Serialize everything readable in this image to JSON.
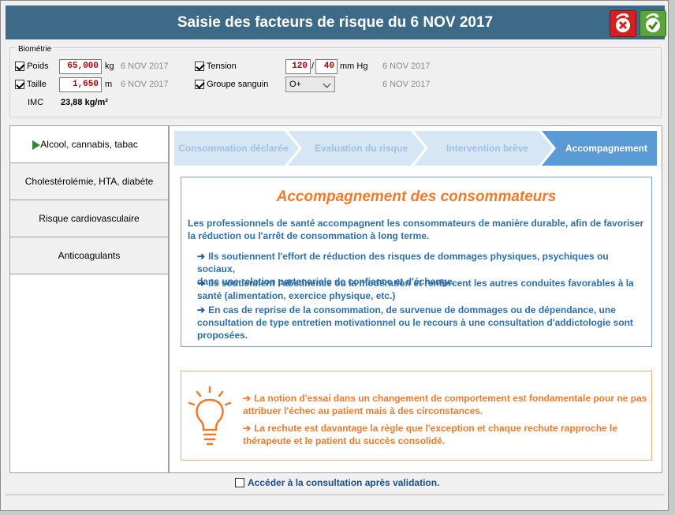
{
  "window": {
    "title": "Saisie des facteurs de risque du 6 NOV 2017"
  },
  "toolbar": {
    "cancel_icon": "cancel-icon",
    "validate_icon": "validate-icon"
  },
  "biometrie": {
    "legend": "Biométrie",
    "poids": {
      "label": "Poids",
      "value": "65,000",
      "unit": "kg",
      "date": "6 NOV 2017",
      "checked": true
    },
    "taille": {
      "label": "Taille",
      "value": "1,650",
      "unit": "m",
      "date": "6 NOV 2017",
      "checked": true
    },
    "imc": {
      "label": "IMC",
      "value": "23,88 kg/m²"
    },
    "tension": {
      "label": "Tension",
      "systolic": "120",
      "separator": "/",
      "diastolic": "40",
      "unit": "mm Hg",
      "date": "6 NOV 2017",
      "checked": true
    },
    "groupe": {
      "label": "Groupe sanguin",
      "value": "O+",
      "date": "6 NOV 2017",
      "checked": true
    }
  },
  "nav": {
    "items": [
      {
        "label": "Alcool, cannabis, tabac",
        "active": true
      },
      {
        "label": "Cholestérolémie, HTA, diabète"
      },
      {
        "label": "Risque cardiovasculaire"
      },
      {
        "label": "Anticoagulants"
      }
    ]
  },
  "steps": {
    "items": [
      {
        "label": "Consommation déclarée"
      },
      {
        "label": "Evaluation du risque"
      },
      {
        "label": "Intervention brève"
      },
      {
        "label": "Accompagnement",
        "active": true
      }
    ]
  },
  "info": {
    "title": "Accompagnement des consommateurs",
    "intro_1": "Les professionnels de santé accompagnent les consommateurs de manière durable, afin de favoriser",
    "intro_2": "la réduction ou l'arrêt de consommation à long terme.",
    "b1_1": "Ils soutiennent l'effort de réduction des risques de dommages physiques, psychiques ou sociaux,",
    "b1_2": "dans une relation partenariale de confiance et d'échange.",
    "b2_1": "Ils soutiennent l'abstinence ou la modération et renforcent les autres conduites favorables à la",
    "b2_2": "santé (alimentation, exercice physique, etc.)",
    "b3_1": "En cas de reprise de la consommation, de survenue de dommages ou de dépendance, une",
    "b3_2": "consultation de type entretien motivationnel ou le recours à une consultation d'addictologie sont",
    "b3_3": "proposées."
  },
  "tip": {
    "icon": "lightbulb-icon",
    "t1_1": "La notion d'essai dans un changement de comportement est fondamentale pour ne pas",
    "t1_2": "attribuer l'échec au patient mais à des circonstances.",
    "t2_1": "La rechute est davantage la règle que l'exception et chaque rechute rapproche le",
    "t2_2": "thérapeute et le patient du succès consolidé."
  },
  "footer": {
    "checkbox_label": "Accéder à la consultation après validation.",
    "checked": false
  },
  "colors": {
    "title_bar": "#3d6a86",
    "accent_orange": "#f07a2a",
    "accent_blue": "#2b6fb0",
    "step_active": "#5b9bd5",
    "step_inactive": "#d6e6f5"
  }
}
